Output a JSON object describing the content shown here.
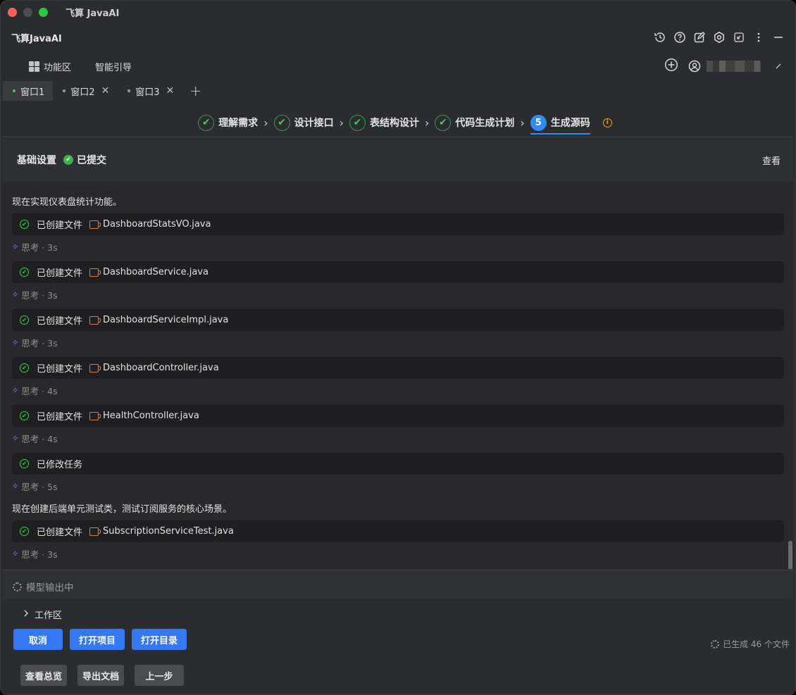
{
  "window": {
    "title": "飞算 JavaAI"
  },
  "header": {
    "app_name": "飞算JavaAI",
    "icons": [
      "history-icon",
      "help-icon",
      "edit-icon",
      "settings-icon",
      "collapse-icon",
      "more-icon",
      "minimize-icon"
    ]
  },
  "nav": {
    "function_area": "功能区",
    "smart_guide": "智能引导"
  },
  "tabs": [
    {
      "label": "窗口1",
      "active": true
    },
    {
      "label": "窗口2",
      "active": false
    },
    {
      "label": "窗口3",
      "active": false
    }
  ],
  "steps": [
    {
      "label": "理解需求",
      "done": true
    },
    {
      "label": "设计接口",
      "done": true
    },
    {
      "label": "表结构设计",
      "done": true
    },
    {
      "label": "代码生成计划",
      "done": true
    },
    {
      "label": "生成源码",
      "number": "5",
      "active": true
    }
  ],
  "base_settings": {
    "label": "基础设置",
    "status": "已提交",
    "view": "查看"
  },
  "log": {
    "intro1": "现在实现仪表盘统计功能。",
    "intro2": "现在创建后端单元测试类，测试订阅服务的核心场景。",
    "entries": [
      {
        "action": "已创建文件",
        "file": "DashboardStatsVO.java",
        "think": "思考 · 3s"
      },
      {
        "action": "已创建文件",
        "file": "DashboardService.java",
        "think": "思考 · 3s"
      },
      {
        "action": "已创建文件",
        "file": "DashboardServiceImpl.java",
        "think": "思考 · 3s"
      },
      {
        "action": "已创建文件",
        "file": "DashboardController.java",
        "think": "思考 · 4s"
      },
      {
        "action": "已创建文件",
        "file": "HealthController.java",
        "think": "思考 · 4s"
      },
      {
        "action": "已修改任务",
        "file": "",
        "think": "思考 · 5s"
      },
      {
        "action": "已创建文件",
        "file": "SubscriptionServiceTest.java",
        "think": "思考 · 3s"
      }
    ]
  },
  "model_output": "模型输出中",
  "workspace": "工作区",
  "buttons": {
    "cancel": "取消",
    "open_project": "打开项目",
    "open_dir": "打开目录",
    "overview": "查看总览",
    "export_doc": "导出文档",
    "prev_step": "上一步"
  },
  "generated_status": "已生成 46 个文件",
  "colors": {
    "accent_blue": "#3478f6",
    "success_green": "#45c75b",
    "file_orange": "#e07b38",
    "warning_yellow": "#e0a82a"
  }
}
